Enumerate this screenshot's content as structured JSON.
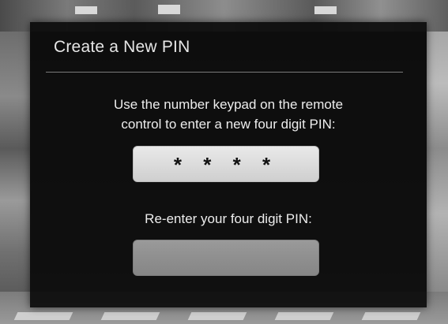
{
  "dialog": {
    "title": "Create a New PIN",
    "instruction_line1": "Use the number keypad on the remote",
    "instruction_line2": "control to enter a new four digit PIN:",
    "pin_field_1": {
      "value": "* * * *"
    },
    "reenter_label": "Re-enter your four digit PIN:",
    "pin_field_2": {
      "value": ""
    }
  }
}
